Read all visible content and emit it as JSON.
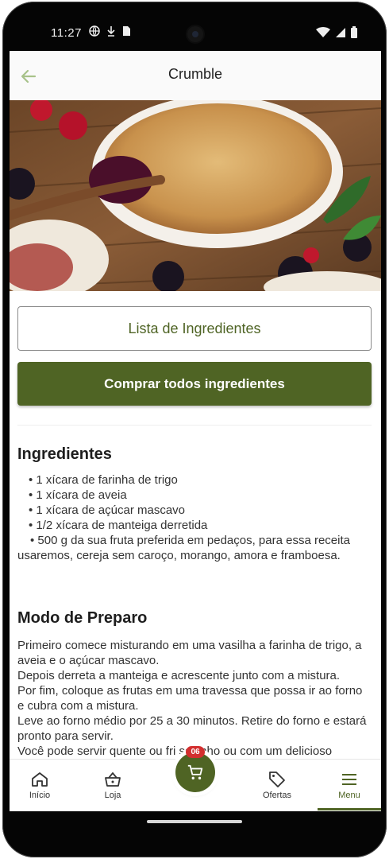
{
  "status_bar": {
    "time": "11:27"
  },
  "app_bar": {
    "title": "Crumble"
  },
  "buttons": {
    "ingredients_list": "Lista de Ingredientes",
    "buy_all": "Comprar todos ingredientes"
  },
  "ingredients": {
    "title": "Ingredientes",
    "items": [
      "• 1 xícara de farinha de trigo",
      "• 1 xícara de aveia",
      "• 1 xícara de açúcar mascavo",
      "• 1/2 xícara de manteiga derretida",
      "• 500 g da sua fruta preferida em pedaços, para essa receita usaremos, cereja sem caroço, morango, amora e framboesa."
    ]
  },
  "preparation": {
    "title": "Modo de Preparo",
    "lines": [
      "Primeiro comece misturando em uma vasilha a farinha de trigo, a aveia e o açúcar mascavo.",
      "Depois derreta a manteiga e acrescente junto com a mistura.",
      "Por fim, coloque as frutas em uma travessa que possa ir ao forno e cubra com a mistura.",
      "Leve ao forno médio por 25 a 30 minutos. Retire do forno e estará pronto para servir.",
      "Você pode servir quente ou fri sozinho ou com um delicioso"
    ]
  },
  "bottom_nav": {
    "items": [
      {
        "label": "Início",
        "icon": "home-icon"
      },
      {
        "label": "Loja",
        "icon": "basket-icon"
      },
      {
        "label": "Ofertas",
        "icon": "tag-icon"
      },
      {
        "label": "Menu",
        "icon": "menu-icon"
      }
    ],
    "cart_badge": "06",
    "active": "Menu"
  },
  "colors": {
    "accent": "#4f6424",
    "badge": "#d32f2f"
  }
}
